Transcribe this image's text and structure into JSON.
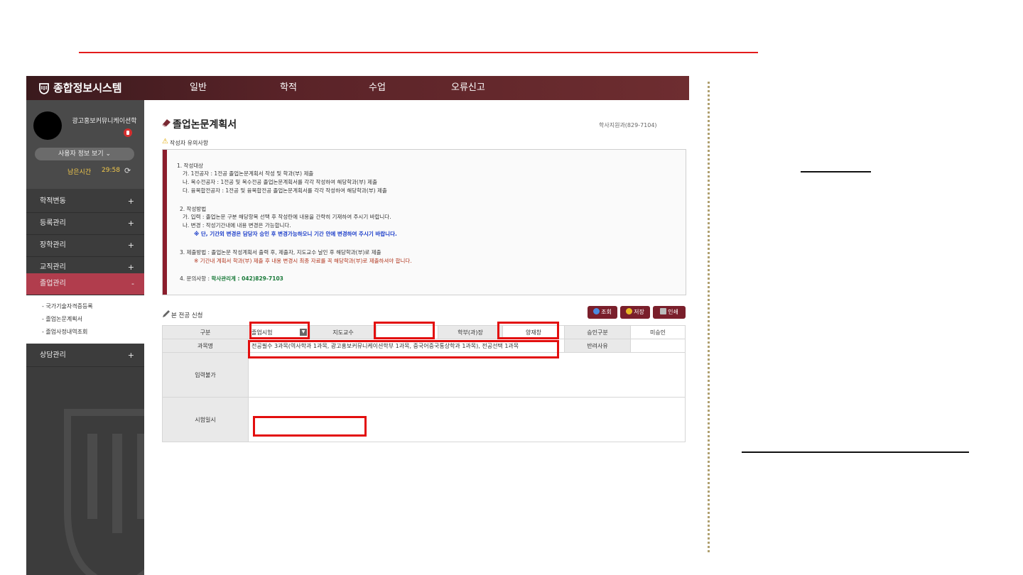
{
  "brand": "종합정보시스템",
  "nav": [
    "일반",
    "학적",
    "수업",
    "오류신고"
  ],
  "profile": {
    "dept": "광고홍보커뮤니케이션학",
    "userinfo_button": "사용자 정보 보기",
    "remain_label": "남은시간",
    "remain_time": "29:58"
  },
  "menu": [
    {
      "label": "학적변동",
      "sign": "+"
    },
    {
      "label": "등록관리",
      "sign": "+"
    },
    {
      "label": "장학관리",
      "sign": "+"
    },
    {
      "label": "교직관리",
      "sign": "+"
    },
    {
      "label": "졸업관리",
      "sign": "-"
    },
    {
      "label": "상담관리",
      "sign": "+"
    }
  ],
  "submenu": [
    "- 국가기술자격증등록",
    "- 졸업논문계획서",
    "- 졸업사정내역조회"
  ],
  "page": {
    "title": "졸업논문계획서",
    "office_contact": "학사지원과(829-7104)",
    "warning_label": "작성자 유의사항",
    "section_title": "본 전공 신청"
  },
  "notice": {
    "s1": "1. 작성대상",
    "s1a": "가. 1전공자 : 1전공 졸업논문계획서 작성 및 학과(부) 제출",
    "s1b": "나. 복수전공자 : 1전공 및 복수전공 졸업논문계획서를 각각 작성하여 해당학과(부) 제출",
    "s1c": "다. 융복합전공자 : 1전공 및 융복합전공 졸업논문계획서를 각각 작성하여 해당학과(부) 제출",
    "s2": "2. 작성방법",
    "s2a": "가. 입력 : 졸업논문 구분 해당항목 선택 후 작성란에 내용을 간략히 기재하여 주시기 바랍니다.",
    "s2b": "나. 변경 : 작성기간내에 내용 변경은 가능합니다.",
    "s2c": "※ 단, 기간외 변경은 담당자 승인 후 변경가능하오니 기간 안에 변경하여 주시기 바랍니다.",
    "s3": "3. 제출방법 : 졸업논문 작성계획서 출력 후, 제출자, 지도교수 날인 후 해당학과(부)로 제출",
    "s3a": "※ 기간내 계획서 학과(부) 제출 후 내용 변경시 최종 자료를 꼭 해당학과(부)로 제출하셔야 합니다.",
    "s4_prefix": "4. 문의사항 : ",
    "s4_contact": "학사관리계 : 042)829-7103"
  },
  "buttons": {
    "search": "조회",
    "save": "저장",
    "print": "인쇄"
  },
  "form": {
    "gubun_label": "구분",
    "gubun_value": "졸업시험",
    "advisor_label": "지도교수",
    "advisor_value": "",
    "head_label": "학부(과)장",
    "head_value": "양재창",
    "approval_label": "승인구분",
    "approval_value": "미승인",
    "subject_label": "과목명",
    "subject_value": "전공필수 3과목(역사학과 1과목, 광고홍보커뮤니케이션학부 1과목, 중국어중국통상학과 1과목), 전공선택 1과목",
    "reject_label": "반려사유",
    "input_label": "입력불가",
    "exam_date_label": "시험일시"
  }
}
